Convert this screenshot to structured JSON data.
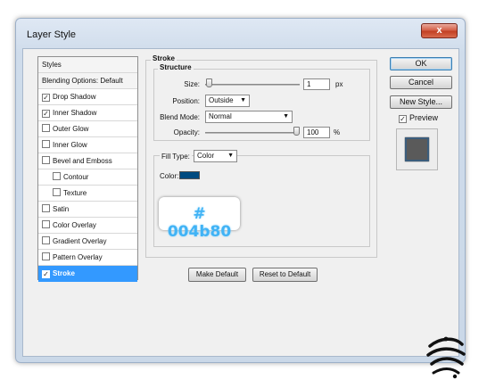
{
  "window": {
    "title": "Layer Style",
    "close_glyph": "x"
  },
  "styles_list": {
    "header": "Styles",
    "blending": "Blending Options: Default",
    "items": [
      {
        "label": "Drop Shadow",
        "checked": true,
        "mark": "✓"
      },
      {
        "label": "Inner Shadow",
        "checked": true,
        "mark": "✓"
      },
      {
        "label": "Outer Glow",
        "checked": false,
        "mark": ""
      },
      {
        "label": "Inner Glow",
        "checked": false,
        "mark": ""
      },
      {
        "label": "Bevel and Emboss",
        "checked": false,
        "mark": ""
      },
      {
        "label": "Contour",
        "checked": false,
        "mark": ""
      },
      {
        "label": "Texture",
        "checked": false,
        "mark": ""
      },
      {
        "label": "Satin",
        "checked": false,
        "mark": ""
      },
      {
        "label": "Color Overlay",
        "checked": false,
        "mark": ""
      },
      {
        "label": "Gradient Overlay",
        "checked": false,
        "mark": ""
      },
      {
        "label": "Pattern Overlay",
        "checked": false,
        "mark": ""
      },
      {
        "label": "Stroke",
        "checked": true,
        "mark": "✓",
        "selected": true
      }
    ]
  },
  "stroke": {
    "group_title": "Stroke",
    "structure_title": "Structure",
    "size": {
      "label": "Size:",
      "value": "1",
      "unit": "px"
    },
    "position": {
      "label": "Position:",
      "value": "Outside"
    },
    "blend_mode": {
      "label": "Blend Mode:",
      "value": "Normal"
    },
    "opacity": {
      "label": "Opacity:",
      "value": "100",
      "unit": "%"
    },
    "fill_type": {
      "label": "Fill Type:",
      "value": "Color"
    },
    "color": {
      "label": "Color:",
      "hex": "#004b80"
    },
    "hex_annotation": "# 004b80",
    "make_default": "Make Default",
    "reset_default": "Reset to Default"
  },
  "buttons": {
    "ok": "OK",
    "cancel": "Cancel",
    "new_style": "New Style..."
  },
  "preview": {
    "label": "Preview",
    "checked": true,
    "mark": "✓"
  },
  "icons": {
    "dropdown": "chevron-down-icon",
    "check": "check-icon"
  }
}
